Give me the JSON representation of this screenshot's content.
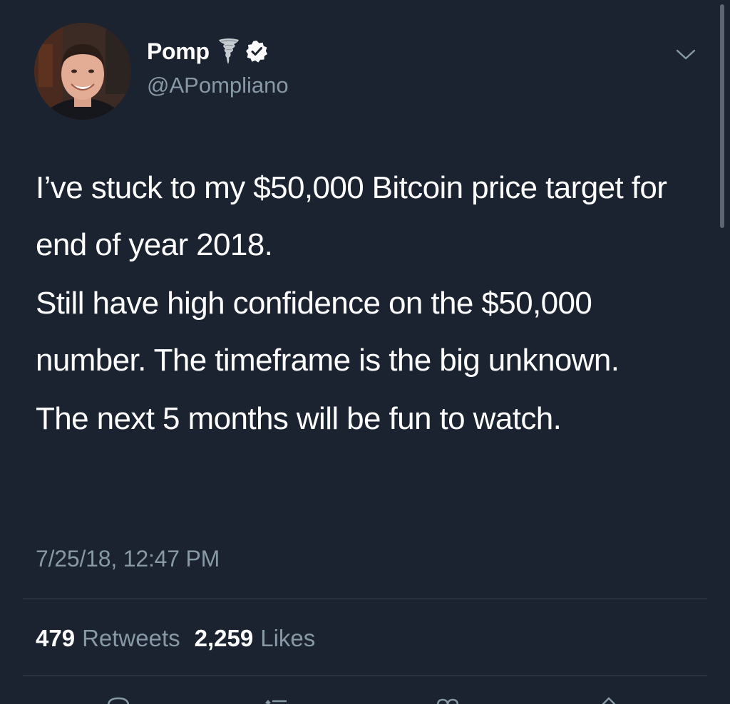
{
  "author": {
    "display_name": "Pomp",
    "handle": "@APompliano"
  },
  "icons": {
    "avatar": "profile-photo",
    "name_emoji": "tornado-icon",
    "verified": "verified-badge-icon",
    "menu": "chevron-down-icon",
    "actions": [
      "reply-icon",
      "retweet-icon",
      "like-icon",
      "share-icon"
    ]
  },
  "tweet": {
    "paragraphs": [
      "I’ve stuck to my $50,000 Bitcoin price target for end of year 2018.",
      "Still have high confidence on the $50,000 number. The timeframe is the big unknown.",
      "The next 5 months will be fun to watch."
    ],
    "timestamp": "7/25/18, 12:47 PM"
  },
  "stats": {
    "retweets_count": "479",
    "retweets_label": "Retweets",
    "likes_count": "2,259",
    "likes_label": "Likes"
  },
  "colors": {
    "background": "#1b2230",
    "text_primary": "#ffffff",
    "text_secondary": "#8899a6",
    "divider": "#38444d"
  }
}
